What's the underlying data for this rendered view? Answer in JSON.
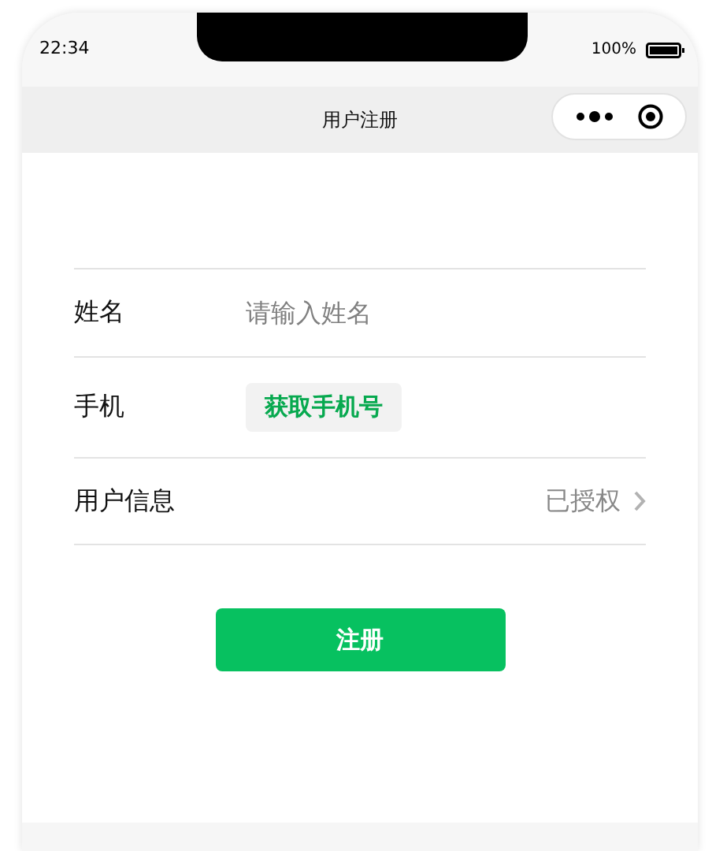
{
  "status_bar": {
    "time": "22:34",
    "battery": "100%"
  },
  "nav_bar": {
    "title": "用户注册"
  },
  "form": {
    "rows": [
      {
        "kind": "input",
        "label": "姓名",
        "placeholder": "请输入姓名"
      },
      {
        "kind": "button",
        "label": "手机",
        "button": "获取手机号"
      },
      {
        "kind": "link",
        "label": "用户信息",
        "value": "已授权"
      }
    ]
  },
  "submit_button": "注册"
}
